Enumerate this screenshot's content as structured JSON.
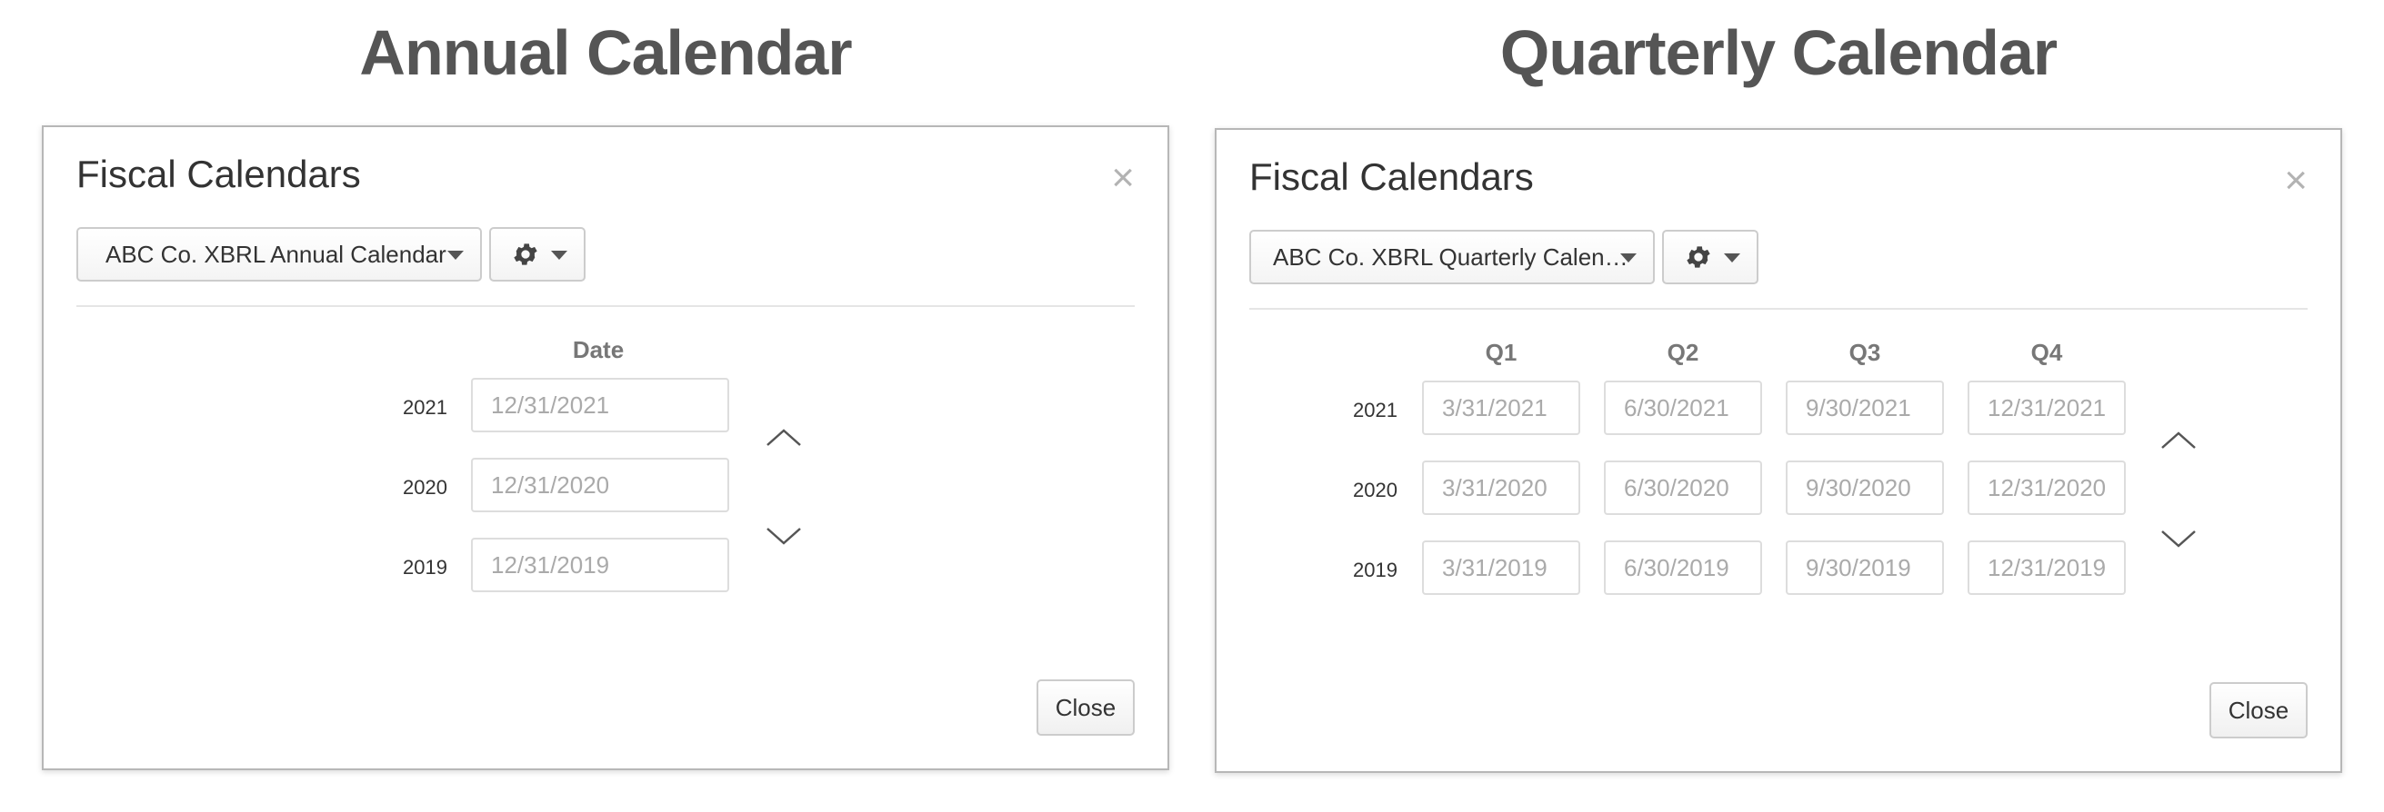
{
  "annual": {
    "heading": "Annual Calendar",
    "dialog": {
      "title": "Fiscal Calendars",
      "close_glyph": "×",
      "calendar_select": "ABC Co. XBRL Annual Calendar",
      "columns": [
        "Date"
      ],
      "rows": [
        {
          "year": "2021",
          "dates": [
            "12/31/2021"
          ]
        },
        {
          "year": "2020",
          "dates": [
            "12/31/2020"
          ]
        },
        {
          "year": "2019",
          "dates": [
            "12/31/2019"
          ]
        }
      ],
      "close_button": "Close"
    }
  },
  "quarterly": {
    "heading": "Quarterly Calendar",
    "dialog": {
      "title": "Fiscal Calendars",
      "close_glyph": "×",
      "calendar_select": "ABC Co. XBRL Quarterly Calen…",
      "columns": [
        "Q1",
        "Q2",
        "Q3",
        "Q4"
      ],
      "rows": [
        {
          "year": "2021",
          "dates": [
            "3/31/2021",
            "6/30/2021",
            "9/30/2021",
            "12/31/2021"
          ]
        },
        {
          "year": "2020",
          "dates": [
            "3/31/2020",
            "6/30/2020",
            "9/30/2020",
            "12/31/2020"
          ]
        },
        {
          "year": "2019",
          "dates": [
            "3/31/2019",
            "6/30/2019",
            "9/30/2019",
            "12/31/2019"
          ]
        }
      ],
      "close_button": "Close"
    }
  },
  "icons": {
    "settings": "gear-icon",
    "dropdown": "caret-down-icon",
    "scroll_up": "chevron-up-icon",
    "scroll_down": "chevron-down-icon",
    "dismiss": "close-icon"
  },
  "colors": {
    "heading": "#555555",
    "border": "#b7b7b7",
    "input_text": "#aaaaaa",
    "column_header": "#777777"
  }
}
